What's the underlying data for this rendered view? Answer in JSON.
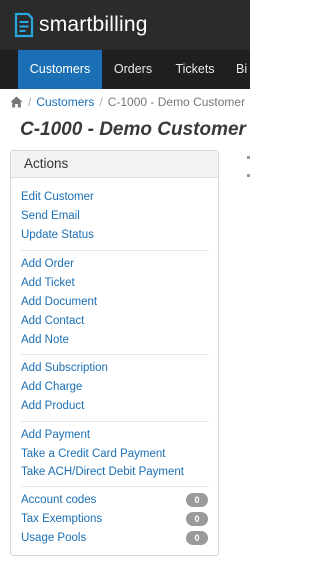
{
  "app": {
    "logo_text": "smartbilling"
  },
  "nav": {
    "items": [
      {
        "label": "Customers",
        "active": true
      },
      {
        "label": "Orders",
        "active": false
      },
      {
        "label": "Tickets",
        "active": false
      },
      {
        "label": "Bi",
        "active": false
      }
    ]
  },
  "breadcrumb": {
    "home_icon": "home-icon",
    "customers": "Customers",
    "current": "C-1000 - Demo Customer"
  },
  "page": {
    "title": "C-1000 - Demo Customer"
  },
  "actions": {
    "heading": "Actions",
    "items": [
      {
        "label": "Edit Customer"
      },
      {
        "label": "Send Email"
      },
      {
        "label": "Update Status"
      },
      {
        "label": "Add Order"
      },
      {
        "label": "Add Ticket"
      },
      {
        "label": "Add Document"
      },
      {
        "label": "Add Contact"
      },
      {
        "label": "Add Note"
      },
      {
        "label": "Add Subscription"
      },
      {
        "label": "Add Charge"
      },
      {
        "label": "Add Product"
      },
      {
        "label": "Add Payment"
      },
      {
        "label": "Take a Credit Card Payment"
      },
      {
        "label": "Take ACH/Direct Debit Payment"
      },
      {
        "label": "Account codes",
        "count": "0"
      },
      {
        "label": "Tax Exemptions",
        "count": "0"
      },
      {
        "label": "Usage Pools",
        "count": "0"
      }
    ]
  },
  "colors": {
    "topbar": "#2b2b2b",
    "navbar": "#1f1f1f",
    "accent": "#1b6fb4",
    "badge": "#9a9a9a"
  }
}
